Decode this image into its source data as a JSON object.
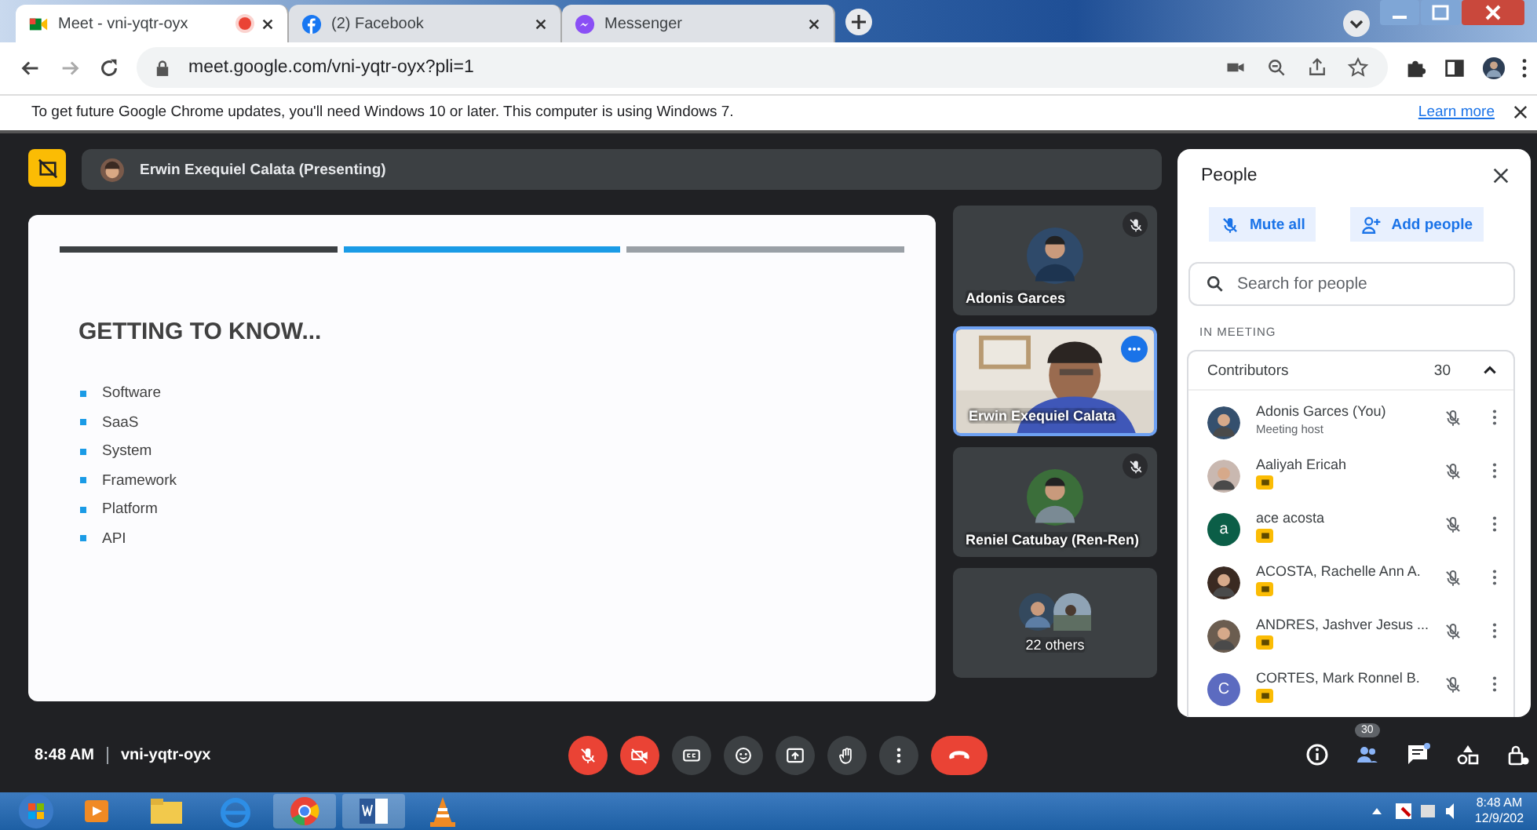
{
  "browser": {
    "tabs": [
      {
        "kind": "meet",
        "title": "Meet - vni-yqtr-oyx",
        "selected": true,
        "recording": true
      },
      {
        "kind": "facebook",
        "title": "(2) Facebook",
        "selected": false,
        "recording": false
      },
      {
        "kind": "messenger",
        "title": "Messenger",
        "selected": false,
        "recording": false
      }
    ],
    "url": "meet.google.com/vni-yqtr-oyx?pli=1",
    "infobar": {
      "text": "To get future Google Chrome updates, you'll need Windows 10 or later. This computer is using Windows 7.",
      "link": "Learn more"
    }
  },
  "presenter_bar": {
    "name": "Erwin Exequiel Calata (Presenting)"
  },
  "slide": {
    "segments": [
      {
        "color": "#3c4043"
      },
      {
        "color": "#1a9be6"
      },
      {
        "color": "#9aa0a6"
      }
    ],
    "heading": "GETTING TO KNOW...",
    "bullets": [
      "Software",
      "SaaS",
      "System",
      "Framework",
      "Platform",
      "API"
    ]
  },
  "tiles": [
    {
      "kind": "avatar",
      "name": "Adonis Garces",
      "muted": true,
      "speaking": false
    },
    {
      "kind": "video",
      "name": "Erwin Exequiel Calata",
      "muted": false,
      "speaking": true
    },
    {
      "kind": "avatar",
      "name": "Reniel Catubay (Ren-Ren)",
      "muted": true,
      "speaking": false
    },
    {
      "kind": "others",
      "name": "22 others",
      "muted": false,
      "speaking": false
    }
  ],
  "people": {
    "title": "People",
    "buttons": [
      "Mute all",
      "Add people"
    ],
    "search": {
      "placeholder": "Search for people"
    },
    "section": "IN MEETING",
    "group": {
      "name": "Contributors",
      "count": "30",
      "expanded": true
    },
    "participants": [
      {
        "name": "Adonis Garces (You)",
        "subtitle": "Meeting host",
        "badge": false
      },
      {
        "name": "Aaliyah Ericah",
        "badge": true
      },
      {
        "name": "ace acosta",
        "initial": "a",
        "color": "#0b5e47",
        "badge": true
      },
      {
        "name": "ACOSTA, Rachelle Ann A.",
        "badge": true
      },
      {
        "name": "ANDRES, Jashver Jesus ...",
        "badge": true
      },
      {
        "name": "CORTES, Mark Ronnel B.",
        "initial": "C",
        "color": "#5c6bc0",
        "badge": true
      }
    ]
  },
  "bottom_bar": {
    "time": "8:48 AM",
    "code": "vni-yqtr-oyx",
    "mic_on": false,
    "camera_on": false,
    "people_count": "30"
  },
  "taskbar": {
    "time": "8:48 AM",
    "date": "12/9/202"
  }
}
